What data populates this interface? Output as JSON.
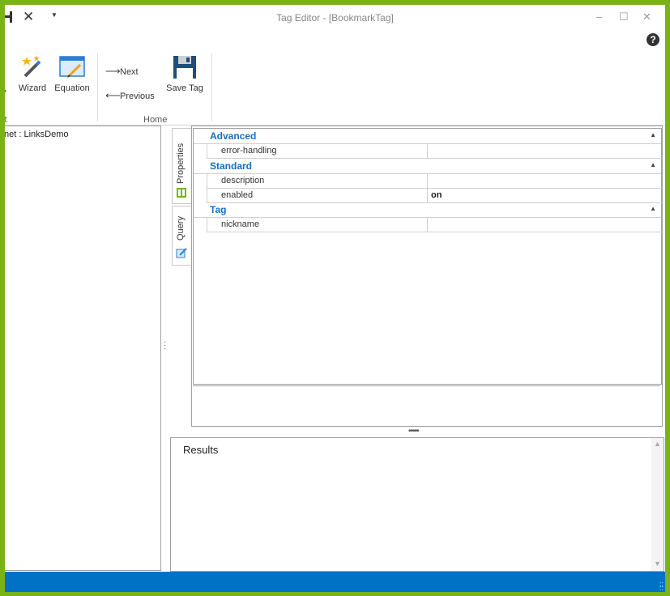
{
  "window": {
    "title": "Tag Editor - [BookmarkTag]",
    "minimize": "–",
    "maximize": "☐",
    "close": "✕",
    "help": "?"
  },
  "qat": {
    "close_glyph": "✕",
    "dropdown_glyph": "▼"
  },
  "ribbon": {
    "partial_left_label": "v",
    "wizard_label": "Wizard",
    "equation_label": "Equation",
    "next_label": "Next",
    "previous_label": "Previous",
    "save_tag_label": "Save Tag",
    "group_partial_label": "ct",
    "group_home_label": "Home"
  },
  "tree": {
    "root": "net : LinksDemo"
  },
  "tabs": [
    {
      "label": "Properties"
    },
    {
      "label": "Query"
    }
  ],
  "propgrid": {
    "categories": [
      {
        "name": "Advanced",
        "rows": [
          {
            "name": "error-handling",
            "value": ""
          }
        ]
      },
      {
        "name": "Standard",
        "rows": [
          {
            "name": "description",
            "value": ""
          },
          {
            "name": "enabled",
            "value": "on"
          }
        ]
      },
      {
        "name": "Tag",
        "rows": [
          {
            "name": "nickname",
            "value": ""
          }
        ]
      }
    ]
  },
  "results": {
    "title": "Results"
  },
  "colors": {
    "accent": "#1b6cbf",
    "statusbar": "#0072c6",
    "frame": "#7ab317"
  }
}
